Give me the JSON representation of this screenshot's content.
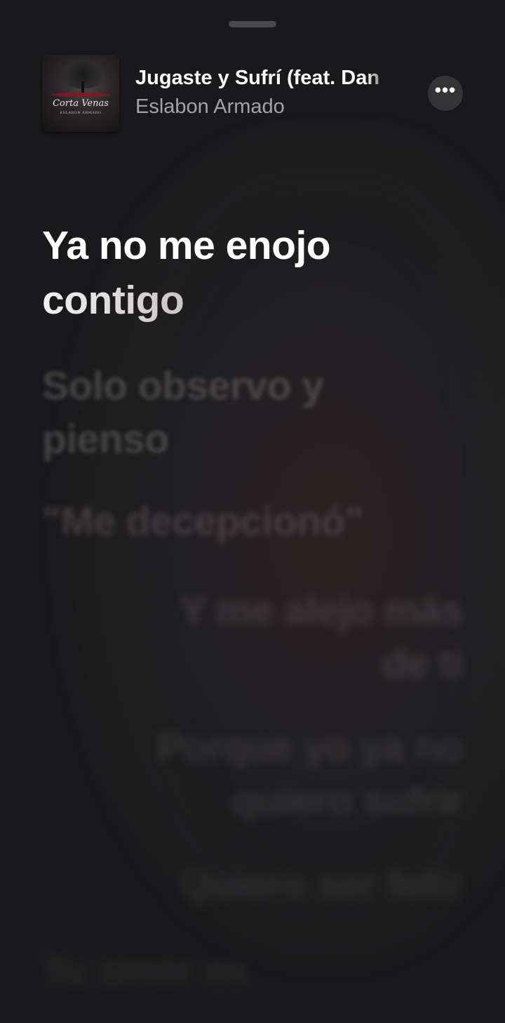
{
  "now_playing": {
    "title": "Jugaste y Sufrí (feat. Dan",
    "artist": "Eslabon Armado",
    "artwork": {
      "title": "Corta Venas",
      "subtitle": "ESLABON ARMADO"
    },
    "more_icon": "ellipsis-icon",
    "more_label": "•••"
  },
  "lyrics": {
    "active": {
      "line_1": "Ya no me enojo",
      "line_2": "contigo"
    },
    "upcoming": [
      {
        "text": "Solo observo y\npienso",
        "align": "left"
      },
      {
        "text": "\"Me decepcionó\"",
        "align": "left"
      },
      {
        "text": "Y me alejo más\nde ti",
        "align": "right"
      },
      {
        "text": "Porque yo ya no\nquiero sufrir",
        "align": "right"
      },
      {
        "text": "Quiero ser feliz",
        "align": "right"
      },
      {
        "text": "Tu amor es",
        "align": "left"
      }
    ]
  },
  "colors": {
    "background": "#1c1c1e",
    "active_lyric": "#ffffff",
    "secondary_text": "#a3a3a7"
  }
}
